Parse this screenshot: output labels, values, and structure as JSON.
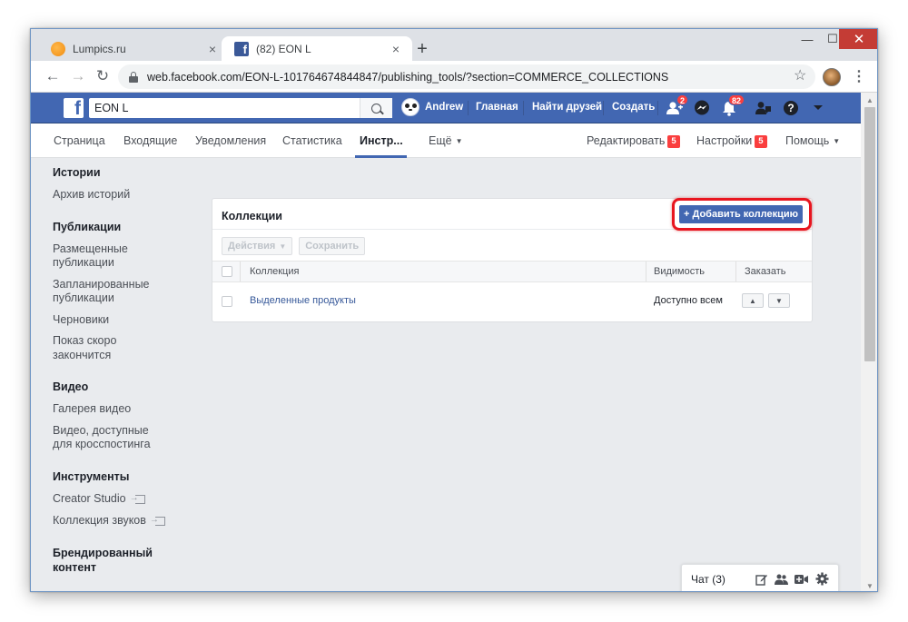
{
  "browser": {
    "tabs": [
      {
        "title": "Lumpics.ru",
        "favicon": "lumpics-favicon"
      },
      {
        "title": "(82) EON L",
        "favicon": "facebook-favicon"
      }
    ],
    "url": "web.facebook.com/EON-L-101764674844847/publishing_tools/?section=COMMERCE_COLLECTIONS",
    "new_tab": "+",
    "close_glyph": "×",
    "win_min": "—",
    "win_max": "☐",
    "win_close": "✕"
  },
  "fb": {
    "logo": "f",
    "search_value": "EON L",
    "user_name": "Andrew",
    "nav_home": "Главная",
    "nav_find_friends": "Найти друзей",
    "nav_create": "Создать",
    "badge_friends": "2",
    "badge_notifications": "82",
    "brand_color": "#4267b2"
  },
  "page_nav": {
    "items": [
      "Страница",
      "Входящие",
      "Уведомления",
      "Статистика",
      "Инстр...",
      "Ещё"
    ],
    "edit_label": "Редактировать",
    "edit_badge": "5",
    "settings_label": "Настройки",
    "settings_badge": "5",
    "help_label": "Помощь"
  },
  "sidebar": {
    "sections": [
      {
        "heading": "Истории",
        "items": [
          "Архив историй"
        ]
      },
      {
        "heading": "Публикации",
        "items": [
          "Размещенные публикации",
          "Запланированные публикации",
          "Черновики",
          "Показ скоро закончится"
        ]
      },
      {
        "heading": "Видео",
        "items": [
          "Галерея видео",
          "Видео, доступные для кросспостинга"
        ]
      },
      {
        "heading": "Инструменты",
        "items": [
          "Creator Studio",
          "Коллекция звуков"
        ]
      },
      {
        "heading": "Брендированный контент",
        "items": []
      }
    ]
  },
  "collections": {
    "title": "Коллекции",
    "add_button": "+ Добавить коллекцию",
    "actions_button": "Действия",
    "save_button": "Сохранить",
    "columns": {
      "collection": "Коллекция",
      "visibility": "Видимость",
      "order": "Заказать"
    },
    "rows": [
      {
        "name": "Выделенные продукты",
        "visibility": "Доступно всем"
      }
    ],
    "highlight_color": "#e8151f"
  },
  "chat": {
    "label": "Чат (3)"
  }
}
